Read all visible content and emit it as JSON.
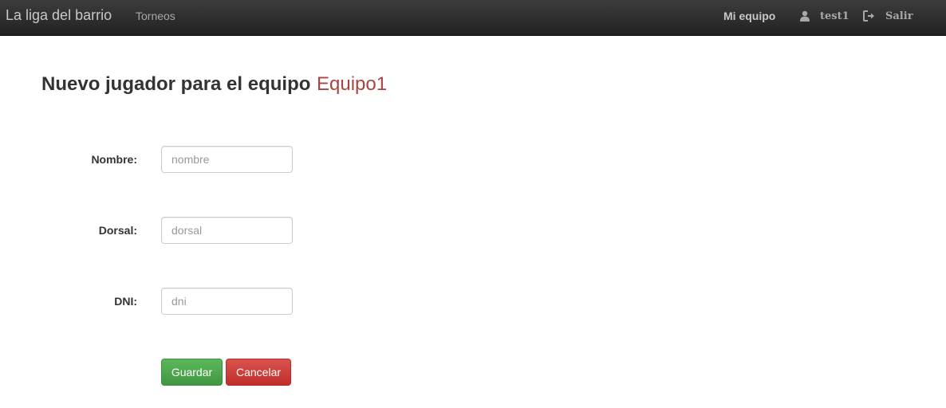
{
  "navbar": {
    "brand": "La liga del barrio",
    "links": {
      "torneos": "Torneos",
      "mi_equipo": "Mi equipo"
    },
    "user": {
      "name": "test1",
      "icon": "user-icon"
    },
    "logout": {
      "label": "Salir",
      "icon": "logout-icon"
    },
    "colors": {
      "background": "#222222",
      "text": "#a8a8a8"
    }
  },
  "page": {
    "heading": "Nuevo jugador para el equipo",
    "team_name": "Equipo1",
    "team_color": "#a94442"
  },
  "form": {
    "nombre": {
      "label": "Nombre:",
      "placeholder": "nombre",
      "value": ""
    },
    "dorsal": {
      "label": "Dorsal:",
      "placeholder": "dorsal",
      "value": ""
    },
    "dni": {
      "label": "DNI:",
      "placeholder": "dni",
      "value": ""
    },
    "save_label": "Guardar",
    "cancel_label": "Cancelar",
    "colors": {
      "save": "#5cb85c",
      "cancel": "#d9534f"
    }
  }
}
